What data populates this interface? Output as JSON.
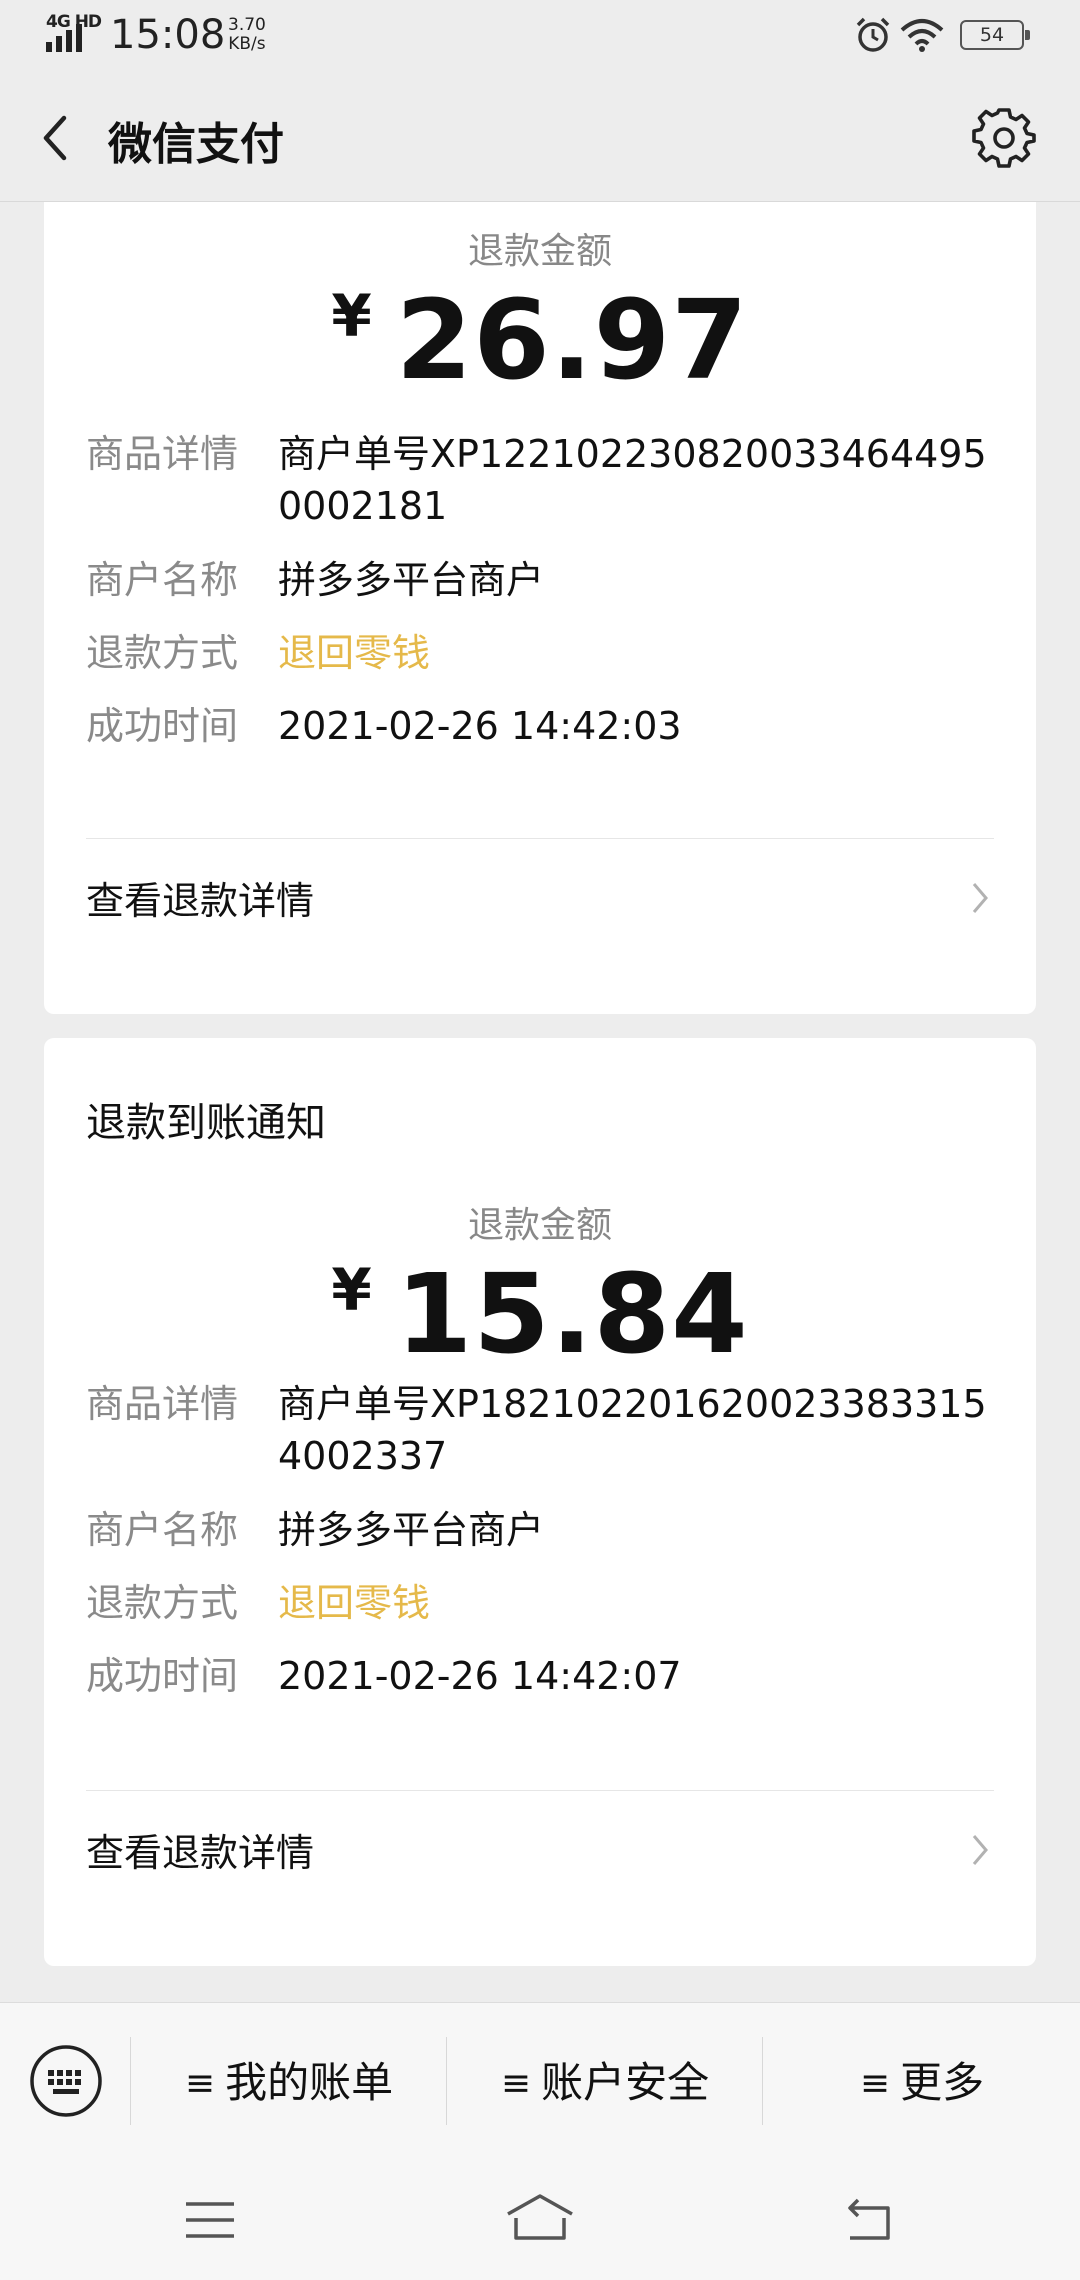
{
  "status_bar": {
    "network": "4G HD",
    "time": "15:08",
    "speed_value": "3.70",
    "speed_unit": "KB/s",
    "battery": "54"
  },
  "header": {
    "title": "微信支付"
  },
  "cards": [
    {
      "heading": "",
      "amount_label": "退款金额",
      "currency": "¥",
      "amount": "26.97",
      "rows": [
        {
          "key": "商品详情",
          "value": "商户单号XP122102230820033464495 0002181"
        },
        {
          "key": "商户名称",
          "value": "拼多多平台商户"
        },
        {
          "key": "退款方式",
          "value": "退回零钱"
        },
        {
          "key": "成功时间",
          "value": "2021-02-26 14:42:03"
        }
      ],
      "detail_link": "查看退款详情"
    },
    {
      "heading": "退款到账通知",
      "amount_label": "退款金额",
      "currency": "¥",
      "amount": "15.84",
      "rows": [
        {
          "key": "商品详情",
          "value": "商户单号XP1821022016200233833154002337"
        },
        {
          "key": "商户名称",
          "value": "拼多多平台商户"
        },
        {
          "key": "退款方式",
          "value": "退回零钱"
        },
        {
          "key": "成功时间",
          "value": "2021-02-26 14:42:07"
        }
      ],
      "detail_link": "查看退款详情"
    }
  ],
  "bottom_menu": {
    "items": [
      {
        "label": "我的账单"
      },
      {
        "label": "账户安全"
      },
      {
        "label": "更多"
      }
    ]
  },
  "colors": {
    "accent_gold": "#e5b94a",
    "background": "#ededed",
    "card": "#ffffff"
  }
}
